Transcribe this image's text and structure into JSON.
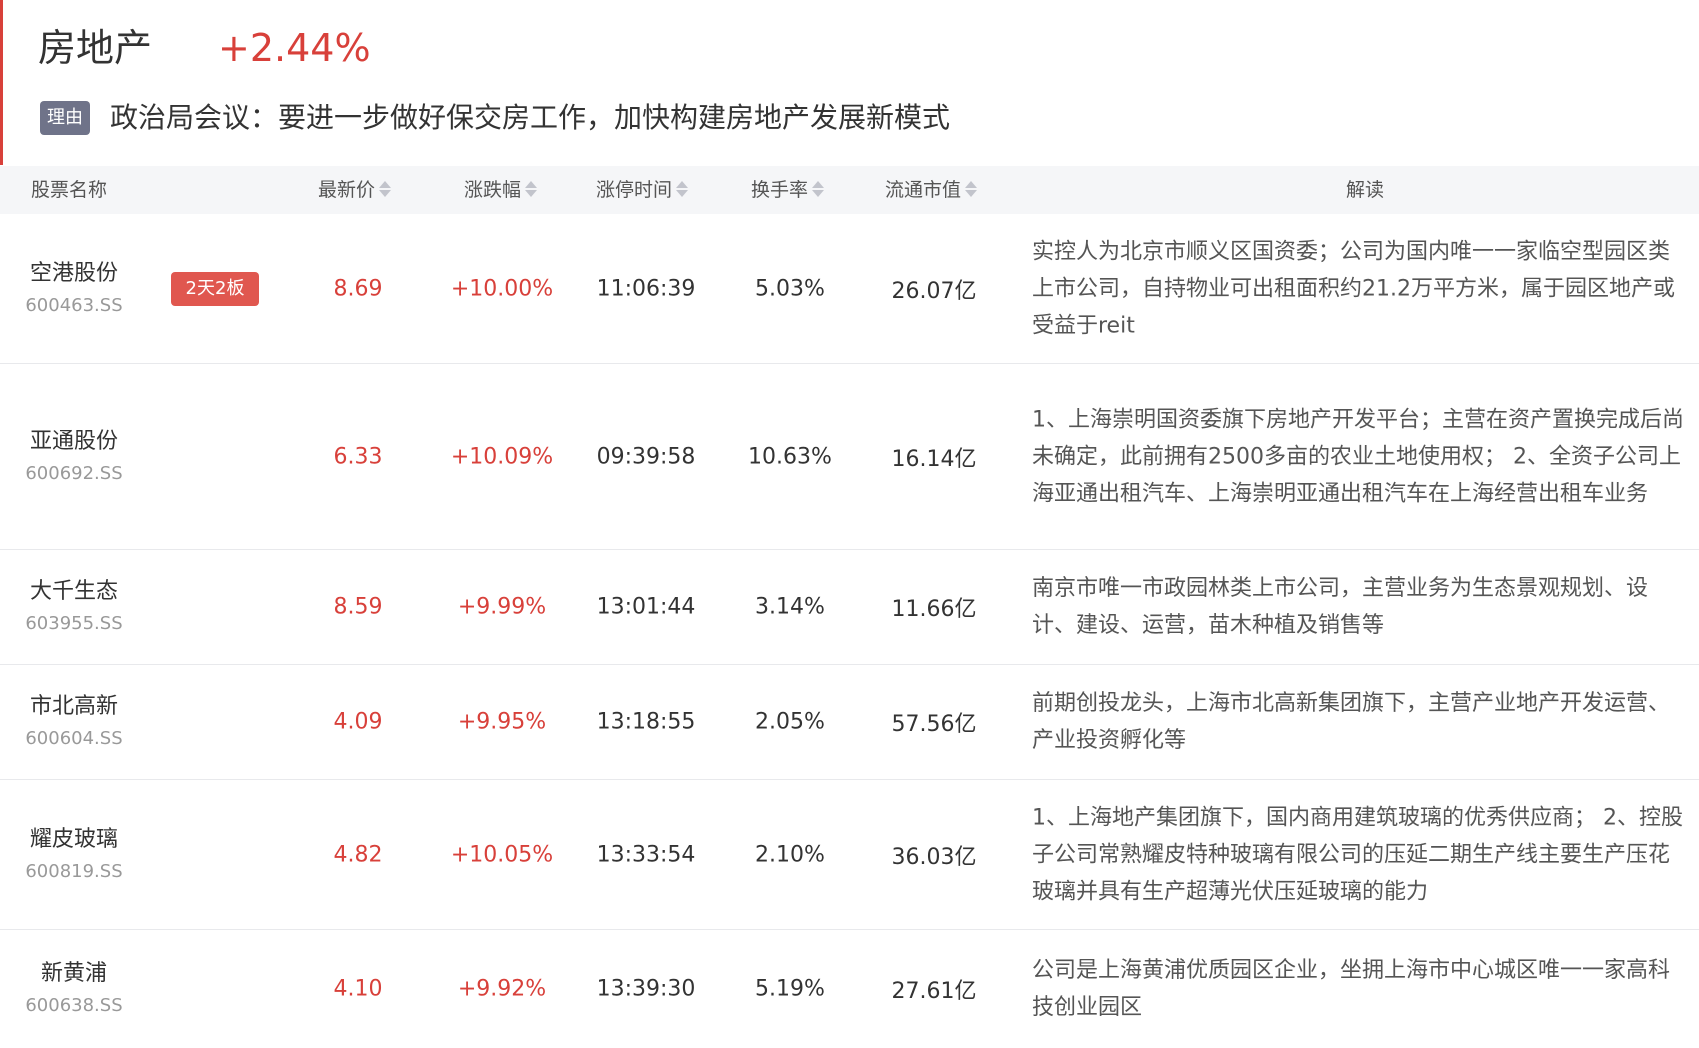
{
  "sector": {
    "name": "房地产",
    "change": "+2.44%",
    "reason_tag": "理由",
    "reason_text": "政治局会议：要进一步做好保交房工作，加快构建房地产发展新模式"
  },
  "table": {
    "headers": {
      "name": "股票名称",
      "price": "最新价",
      "change": "涨跌幅",
      "limit_time": "涨停时间",
      "turnover": "换手率",
      "float_cap": "流通市值",
      "note": "解读"
    },
    "rows": [
      {
        "name": "空港股份",
        "code": "600463.SS",
        "badge": "2天2板",
        "price": "8.69",
        "change": "+10.00%",
        "limit_time": "11:06:39",
        "turnover": "5.03%",
        "float_cap": "26.07亿",
        "note": "实控人为北京市顺义区国资委；公司为国内唯一一家临空型园区类上市公司，自持物业可出租面积约21.2万平方米，属于园区地产或受益于reit"
      },
      {
        "name": "亚通股份",
        "code": "600692.SS",
        "badge": "",
        "price": "6.33",
        "change": "+10.09%",
        "limit_time": "09:39:58",
        "turnover": "10.63%",
        "float_cap": "16.14亿",
        "note": "1、上海崇明国资委旗下房地产开发平台；主营在资产置换完成后尚未确定，此前拥有2500多亩的农业土地使用权； 2、全资子公司上海亚通出租汽车、上海崇明亚通出租汽车在上海经营出租车业务"
      },
      {
        "name": "大千生态",
        "code": "603955.SS",
        "badge": "",
        "price": "8.59",
        "change": "+9.99%",
        "limit_time": "13:01:44",
        "turnover": "3.14%",
        "float_cap": "11.66亿",
        "note": "南京市唯一市政园林类上市公司，主营业务为生态景观规划、设计、建设、运营，苗木种植及销售等"
      },
      {
        "name": "市北高新",
        "code": "600604.SS",
        "badge": "",
        "price": "4.09",
        "change": "+9.95%",
        "limit_time": "13:18:55",
        "turnover": "2.05%",
        "float_cap": "57.56亿",
        "note": "前期创投龙头，上海市北高新集团旗下，主营产业地产开发运营、产业投资孵化等"
      },
      {
        "name": "耀皮玻璃",
        "code": "600819.SS",
        "badge": "",
        "price": "4.82",
        "change": "+10.05%",
        "limit_time": "13:33:54",
        "turnover": "2.10%",
        "float_cap": "36.03亿",
        "note": "1、上海地产集团旗下，国内商用建筑玻璃的优秀供应商； 2、控股子公司常熟耀皮特种玻璃有限公司的压延二期生产线主要生产压花玻璃并具有生产超薄光伏压延玻璃的能力"
      },
      {
        "name": "新黄浦",
        "code": "600638.SS",
        "badge": "",
        "price": "4.10",
        "change": "+9.92%",
        "limit_time": "13:39:30",
        "turnover": "5.19%",
        "float_cap": "27.61亿",
        "note": "公司是上海黄浦优质园区企业，坐拥上海市中心城区唯一一家高科技创业园区"
      }
    ]
  },
  "colors": {
    "up": "#d8403a",
    "badge": "#e0574f",
    "tag": "#6f7389",
    "header_bg": "#f5f6f8"
  }
}
